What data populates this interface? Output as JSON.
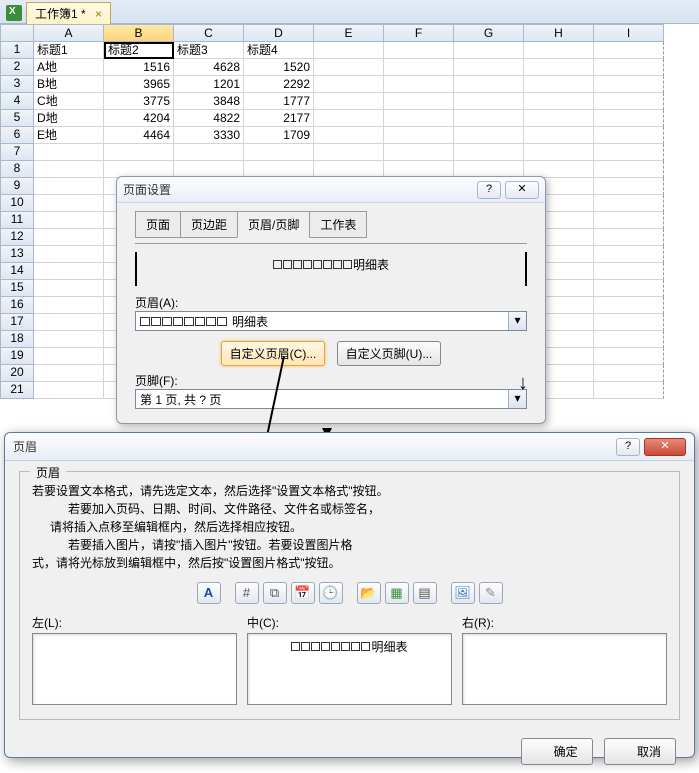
{
  "workbook": {
    "tab_name": "工作簿1 *",
    "tab_close": "×"
  },
  "columns": [
    "A",
    "B",
    "C",
    "D",
    "E",
    "F",
    "G",
    "H",
    "I"
  ],
  "row_numbers": [
    1,
    2,
    3,
    4,
    5,
    6,
    7,
    8,
    9,
    10,
    11,
    12,
    13,
    14,
    15,
    16,
    17,
    18,
    19,
    20,
    21
  ],
  "data": {
    "headers": [
      "标题1",
      "标题2",
      "标题3",
      "标题4"
    ],
    "rows": [
      {
        "label": "A地",
        "v": [
          1516,
          4628,
          1520
        ]
      },
      {
        "label": "B地",
        "v": [
          3965,
          1201,
          2292
        ]
      },
      {
        "label": "C地",
        "v": [
          3775,
          3848,
          1777
        ]
      },
      {
        "label": "D地",
        "v": [
          4204,
          4822,
          2177
        ]
      },
      {
        "label": "E地",
        "v": [
          4464,
          3330,
          1709
        ]
      }
    ]
  },
  "dlg1": {
    "title": "页面设置",
    "help": "?",
    "close": "✕",
    "tabs": [
      "页面",
      "页边距",
      "页眉/页脚",
      "工作表"
    ],
    "active_tab": 2,
    "preview_suffix": "明细表",
    "header_label": "页眉(A):",
    "header_value_suffix": "明细表",
    "custom_header_btn": "自定义页眉(C)...",
    "custom_footer_btn": "自定义页脚(U)...",
    "footer_label": "页脚(F):",
    "footer_value": "第 1 页, 共 ? 页",
    "dd": "▾"
  },
  "dlg2": {
    "title": "页眉",
    "help": "?",
    "close": "✕",
    "legend": "页眉",
    "lines": [
      "若要设置文本格式，请先选定文本，然后选择\"设置文本格式\"按钮。",
      "若要加入页码、日期、时间、文件路径、文件名或标签名，",
      "请将插入点移至编辑框内，然后选择相应按钮。",
      "若要插入图片，请按\"插入图片\"按钮。若要设置图片格",
      "式，请将光标放到编辑框中，然后按\"设置图片格式\"按钮。"
    ],
    "toolbar_icons": [
      {
        "name": "format-text-icon",
        "glyph": "A",
        "color": "#1a4aa8"
      },
      {
        "name": "page-number-icon",
        "glyph": "#",
        "color": "#555"
      },
      {
        "name": "pages-icon",
        "glyph": "⧉",
        "color": "#555"
      },
      {
        "name": "date-icon",
        "glyph": "📅",
        "color": "#555"
      },
      {
        "name": "time-icon",
        "glyph": "🕒",
        "color": "#555"
      },
      {
        "name": "file-path-icon",
        "glyph": "📂",
        "color": "#b88a2a"
      },
      {
        "name": "file-name-icon",
        "glyph": "▦",
        "color": "#3a8e3a"
      },
      {
        "name": "sheet-name-icon",
        "glyph": "▤",
        "color": "#555"
      },
      {
        "name": "insert-picture-icon",
        "glyph": "🖼",
        "color": "#3a7ebf"
      },
      {
        "name": "format-picture-icon",
        "glyph": "✎",
        "color": "#888"
      }
    ],
    "left_label": "左(L):",
    "center_label": "中(C):",
    "right_label": "右(R):",
    "center_value_suffix": "明细表",
    "ok": "确定",
    "cancel": "取消"
  }
}
